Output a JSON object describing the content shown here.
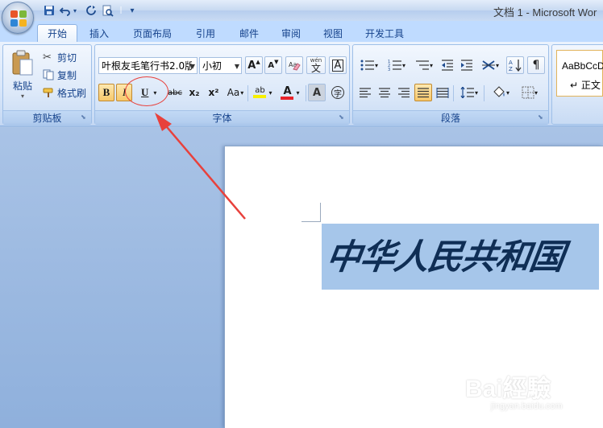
{
  "title_bar": {
    "title": "文档 1 - Microsoft Wor"
  },
  "tabs": [
    {
      "label": "开始",
      "active": true
    },
    {
      "label": "插入"
    },
    {
      "label": "页面布局"
    },
    {
      "label": "引用"
    },
    {
      "label": "邮件"
    },
    {
      "label": "审阅"
    },
    {
      "label": "视图"
    },
    {
      "label": "开发工具"
    }
  ],
  "clipboard": {
    "label": "剪贴板",
    "paste": "粘贴",
    "cut": "剪切",
    "copy": "复制",
    "format_painter": "格式刷"
  },
  "font": {
    "label": "字体",
    "font_name": "叶根友毛笔行书2.0版",
    "font_size": "小初",
    "bold": "B",
    "italic": "I",
    "underline": "U",
    "strikethrough": "abc",
    "subscript": "x₂",
    "superscript": "x²",
    "change_case": "Aa",
    "highlight": "ab",
    "font_color": "A",
    "char_shading": "A",
    "enclose": "字",
    "grow": "A",
    "shrink": "A",
    "phonetic": "wén",
    "border": "A"
  },
  "paragraph": {
    "label": "段落"
  },
  "styles": {
    "sample": "AaBbCcD",
    "normal": "↵ 正文"
  },
  "document": {
    "text": "中华人民共和国"
  },
  "watermark": {
    "brand": "Bai經驗",
    "url": "jingyan.baidu.com"
  },
  "colors": {
    "accent_red": "#e8413c",
    "selection": "#a6c6ea",
    "ribbon_text": "#15428b"
  }
}
